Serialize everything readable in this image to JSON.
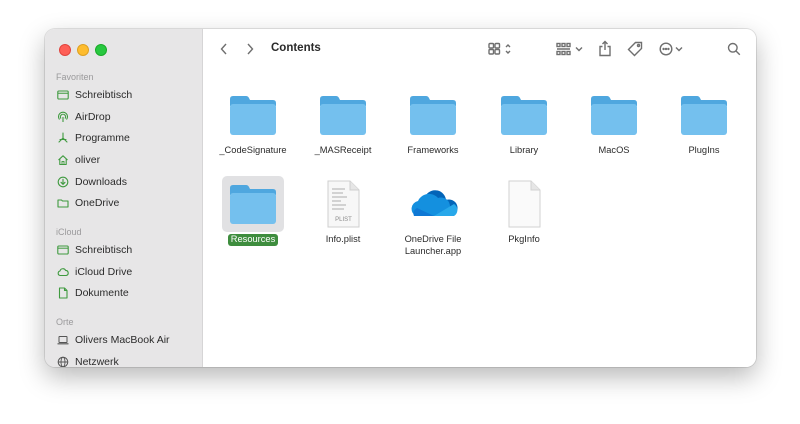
{
  "window": {
    "title": "Contents"
  },
  "sidebar": {
    "sections": [
      {
        "heading": "Favoriten",
        "items": [
          {
            "label": "Schreibtisch",
            "icon": "desktop-icon"
          },
          {
            "label": "AirDrop",
            "icon": "airdrop-icon"
          },
          {
            "label": "Programme",
            "icon": "applications-icon"
          },
          {
            "label": "oliver",
            "icon": "home-icon"
          },
          {
            "label": "Downloads",
            "icon": "downloads-icon"
          },
          {
            "label": "OneDrive",
            "icon": "folder-icon"
          }
        ]
      },
      {
        "heading": "iCloud",
        "items": [
          {
            "label": "Schreibtisch",
            "icon": "desktop-icon"
          },
          {
            "label": "iCloud Drive",
            "icon": "cloud-icon"
          },
          {
            "label": "Dokumente",
            "icon": "document-icon"
          }
        ]
      },
      {
        "heading": "Orte",
        "items": [
          {
            "label": "Olivers MacBook Air",
            "icon": "laptop-icon"
          },
          {
            "label": "Netzwerk",
            "icon": "network-icon"
          }
        ]
      }
    ]
  },
  "files": [
    {
      "name": "_CodeSignature",
      "type": "folder",
      "selected": false
    },
    {
      "name": "_MASReceipt",
      "type": "folder",
      "selected": false
    },
    {
      "name": "Frameworks",
      "type": "folder",
      "selected": false
    },
    {
      "name": "Library",
      "type": "folder",
      "selected": false
    },
    {
      "name": "MacOS",
      "type": "folder",
      "selected": false
    },
    {
      "name": "PlugIns",
      "type": "folder",
      "selected": false
    },
    {
      "name": "Resources",
      "type": "folder",
      "selected": true
    },
    {
      "name": "Info.plist",
      "type": "plist",
      "selected": false
    },
    {
      "name": "OneDrive File Launcher.app",
      "type": "onedrive-app",
      "selected": false
    },
    {
      "name": "PkgInfo",
      "type": "document",
      "selected": false
    }
  ],
  "colors": {
    "sidebar_icon": "#3f9a3f",
    "folder_light": "#74c0ee",
    "folder_dark": "#4fa7df",
    "selection_label": "#3e8d3e"
  }
}
